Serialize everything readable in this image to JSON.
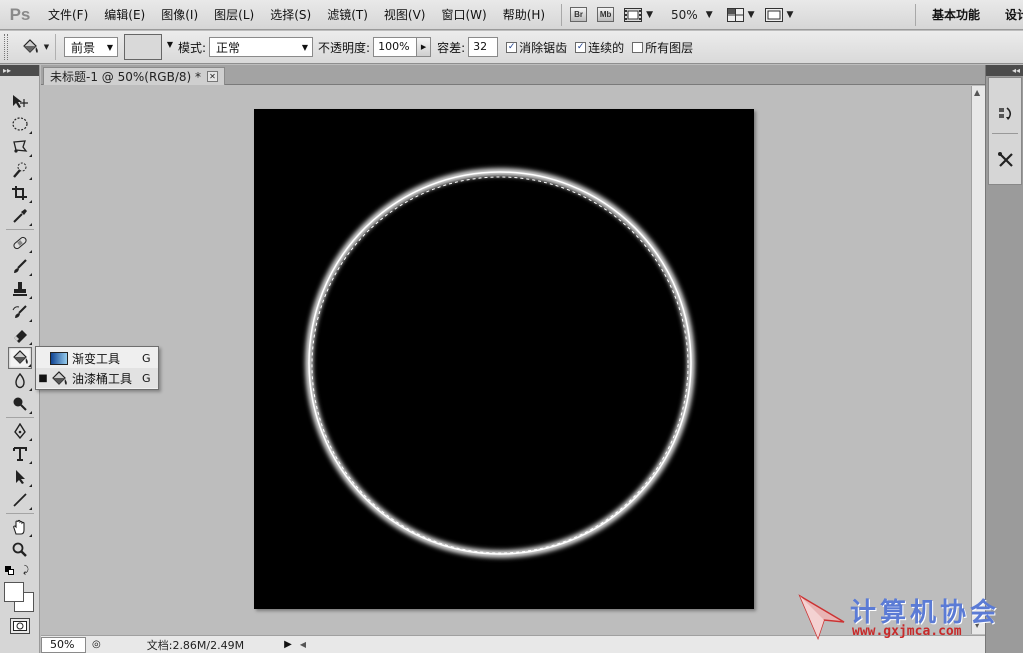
{
  "app": {
    "logo": "Ps"
  },
  "menu": [
    "文件(F)",
    "编辑(E)",
    "图像(I)",
    "图层(L)",
    "选择(S)",
    "滤镜(T)",
    "视图(V)",
    "窗口(W)",
    "帮助(H)"
  ],
  "menubar_controls": {
    "bridge_badge": "Br",
    "minibridge_badge": "Mb",
    "zoom": "50%"
  },
  "workspace": {
    "label": "基本功能",
    "label2": "设计"
  },
  "options": {
    "fill_source": "前景",
    "mode_label": "模式:",
    "mode_value": "正常",
    "opacity_label": "不透明度:",
    "opacity_value": "100%",
    "tolerance_label": "容差:",
    "tolerance_value": "32",
    "antialias_label": "消除锯齿",
    "antialias_checked": true,
    "contiguous_label": "连续的",
    "contiguous_checked": true,
    "all_layers_label": "所有图层",
    "all_layers_checked": false
  },
  "document": {
    "tab_title": "未标题-1 @ 50%(RGB/8) *"
  },
  "status": {
    "zoom": "50%",
    "doc_info": "文档:2.86M/2.49M"
  },
  "flyout": {
    "items": [
      {
        "label": "渐变工具",
        "shortcut": "G",
        "selected": false,
        "icon": "gradient-icon"
      },
      {
        "label": "油漆桶工具",
        "shortcut": "G",
        "selected": true,
        "icon": "paint-bucket-icon"
      }
    ]
  },
  "watermark": {
    "title": "计算机协会",
    "url": "www.gxjmca.com"
  },
  "colors": {
    "canvas": "#000000",
    "workspace_bg": "#bdbdbd",
    "accent": "#5b7bd5"
  }
}
